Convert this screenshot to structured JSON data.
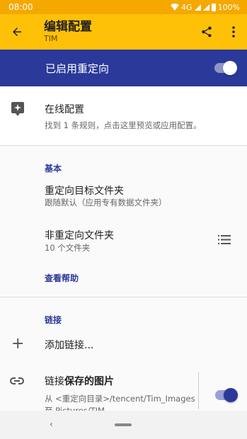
{
  "status_bar": {
    "time": "08:00",
    "network": "4G",
    "battery": "100%"
  },
  "app_bar": {
    "title": "编辑配置",
    "subtitle": "TIM"
  },
  "master_switch": {
    "label": "已启用重定向",
    "enabled": true
  },
  "online_config": {
    "title": "在线配置",
    "description": "找到 1 条规则，点击这里预览或应用配置。"
  },
  "basic": {
    "header": "基本",
    "target_folder": {
      "title": "重定向目标文件夹",
      "subtitle": "跟随默认（应用专有数据文件夹）"
    },
    "non_redirect": {
      "title": "非重定向文件夹",
      "subtitle": "10 个文件夹"
    },
    "help_link": "查看帮助"
  },
  "links": {
    "header": "链接",
    "add_label": "添加链接...",
    "items": [
      {
        "title_prefix": "链接",
        "title_bold": "保存的图片",
        "line1": "从 <重定向目录>/tencent/Tim_Images",
        "line2": "至 Pictures/TIM",
        "enabled": true
      }
    ]
  },
  "colors": {
    "accent": "#2b399a",
    "app_bar": "#ffc107",
    "status_bar": "#f5a800"
  }
}
